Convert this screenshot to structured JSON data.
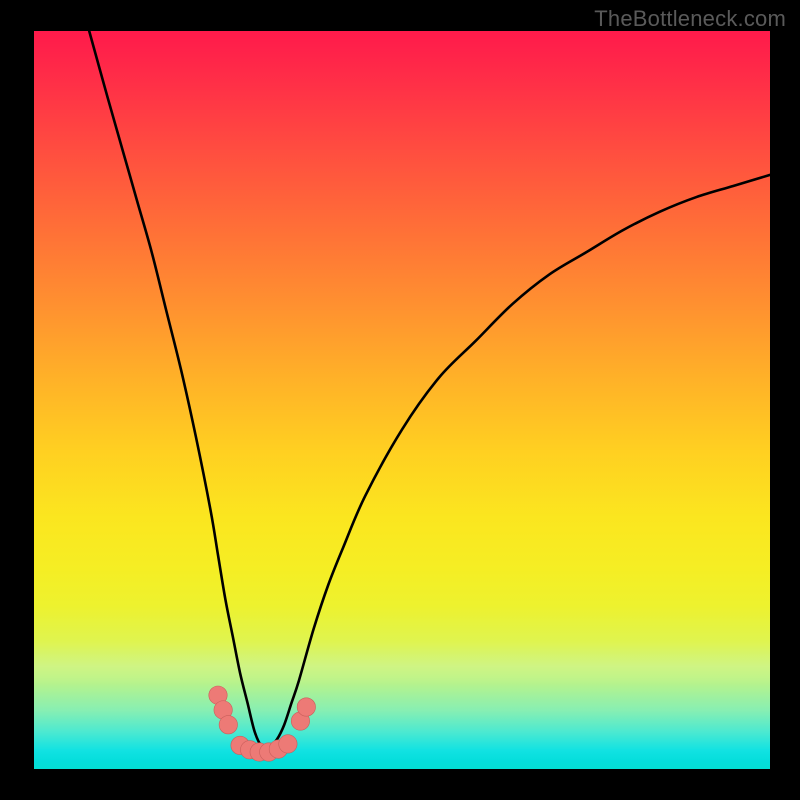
{
  "watermark": "TheBottleneck.com",
  "colors": {
    "curve": "#000000",
    "bead": "#ed7a76",
    "bead_stroke": "#c95e5b"
  },
  "chart_data": {
    "type": "line",
    "title": "",
    "xlabel": "",
    "ylabel": "",
    "xlim": [
      0,
      100
    ],
    "ylim": [
      0,
      100
    ],
    "note": "Axes are unlabeled; values are read as percentages of the plot area. y=0 is bottom (green), y=100 is top (red). The curve plots bottleneck-like magnitude vs. an unlabeled x parameter, with minimum near x≈31.",
    "series": [
      {
        "name": "curve",
        "x": [
          7.5,
          10,
          12,
          14,
          16,
          18,
          20,
          22,
          24,
          25,
          26,
          27,
          28,
          29,
          30,
          31,
          32,
          33,
          34,
          35,
          36,
          38,
          40,
          42,
          45,
          50,
          55,
          60,
          65,
          70,
          75,
          80,
          85,
          90,
          95,
          100
        ],
        "y": [
          100,
          91,
          84,
          77,
          70,
          62,
          54,
          45,
          35,
          29,
          23,
          18,
          13,
          9,
          5,
          3,
          3,
          4,
          6,
          9,
          12,
          19,
          25,
          30,
          37,
          46,
          53,
          58,
          63,
          67,
          70,
          73,
          75.5,
          77.5,
          79,
          80.5
        ]
      }
    ],
    "beads": {
      "name": "highlight-beads",
      "points": [
        {
          "x": 25.0,
          "y": 10.0
        },
        {
          "x": 25.7,
          "y": 8.0
        },
        {
          "x": 26.4,
          "y": 6.0
        },
        {
          "x": 28.0,
          "y": 3.2
        },
        {
          "x": 29.3,
          "y": 2.6
        },
        {
          "x": 30.6,
          "y": 2.3
        },
        {
          "x": 31.9,
          "y": 2.3
        },
        {
          "x": 33.2,
          "y": 2.7
        },
        {
          "x": 34.5,
          "y": 3.4
        },
        {
          "x": 36.2,
          "y": 6.5
        },
        {
          "x": 37.0,
          "y": 8.4
        }
      ],
      "radius_pct": 1.25
    }
  }
}
